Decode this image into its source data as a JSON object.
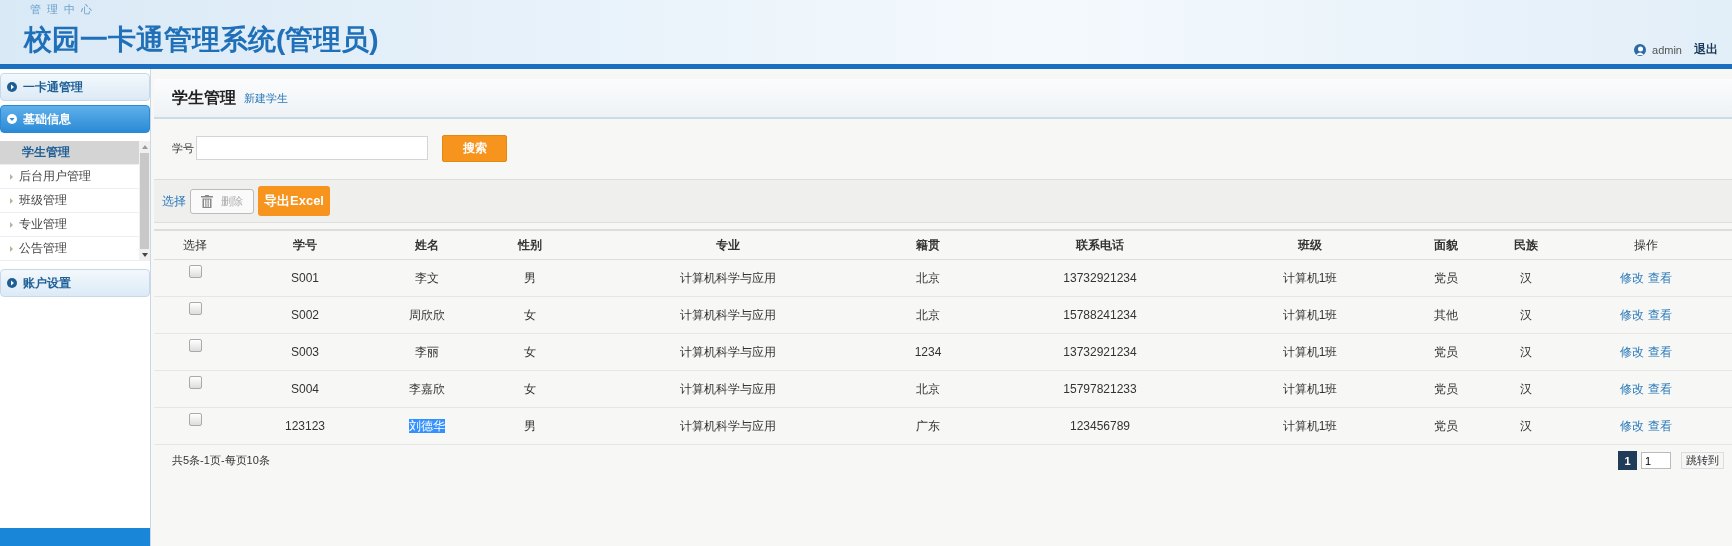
{
  "header": {
    "subtitle": "管理中心",
    "title": "校园一卡通管理系统(管理员)",
    "user": "admin",
    "logout": "退出"
  },
  "sidebar": {
    "groups": [
      {
        "label": "一卡通管理",
        "expanded": false
      },
      {
        "label": "基础信息",
        "expanded": true,
        "items": [
          {
            "label": "学生管理",
            "selected": true
          },
          {
            "label": "后台用户管理",
            "selected": false
          },
          {
            "label": "班级管理",
            "selected": false
          },
          {
            "label": "专业管理",
            "selected": false
          },
          {
            "label": "公告管理",
            "selected": false
          }
        ]
      },
      {
        "label": "账户设置",
        "expanded": false
      }
    ]
  },
  "page": {
    "title": "学生管理",
    "new_link": "新建学生"
  },
  "search": {
    "label": "学号",
    "button": "搜索"
  },
  "toolbar": {
    "select": "选择",
    "delete": {
      "label": "删除",
      "disabled": true
    },
    "export": "导出Excel"
  },
  "table": {
    "columns": [
      "选择",
      "学号",
      "姓名",
      "性别",
      "专业",
      "籍贯",
      "联系电话",
      "班级",
      "面貌",
      "民族",
      "操作"
    ],
    "rows": [
      {
        "checked": false,
        "cells": [
          "",
          "S001",
          "李文",
          "男",
          "计算机科学与应用",
          "北京",
          "13732921234",
          "计算机1班",
          "党员",
          "汉"
        ],
        "name_highlighted": false,
        "actions": [
          "修改",
          "查看"
        ]
      },
      {
        "checked": false,
        "cells": [
          "",
          "S002",
          "周欣欣",
          "女",
          "计算机科学与应用",
          "北京",
          "15788241234",
          "计算机1班",
          "其他",
          "汉"
        ],
        "name_highlighted": false,
        "actions": [
          "修改",
          "查看"
        ]
      },
      {
        "checked": false,
        "cells": [
          "",
          "S003",
          "李丽",
          "女",
          "计算机科学与应用",
          "1234",
          "13732921234",
          "计算机1班",
          "党员",
          "汉"
        ],
        "name_highlighted": false,
        "actions": [
          "修改",
          "查看"
        ]
      },
      {
        "checked": false,
        "cells": [
          "",
          "S004",
          "李嘉欣",
          "女",
          "计算机科学与应用",
          "北京",
          "15797821233",
          "计算机1班",
          "党员",
          "汉"
        ],
        "name_highlighted": false,
        "actions": [
          "修改",
          "查看"
        ]
      },
      {
        "checked": false,
        "cells": [
          "",
          "123123",
          "刘德华",
          "男",
          "计算机科学与应用",
          "广东",
          "123456789",
          "计算机1班",
          "党员",
          "汉"
        ],
        "name_highlighted": true,
        "actions": [
          "修改",
          "查看"
        ]
      }
    ]
  },
  "footer": {
    "summary": "共5条-1页-每页10条",
    "pages": [
      {
        "label": "1",
        "selected": true
      }
    ],
    "jump_value": "1",
    "jump_button": "跳转到"
  }
}
